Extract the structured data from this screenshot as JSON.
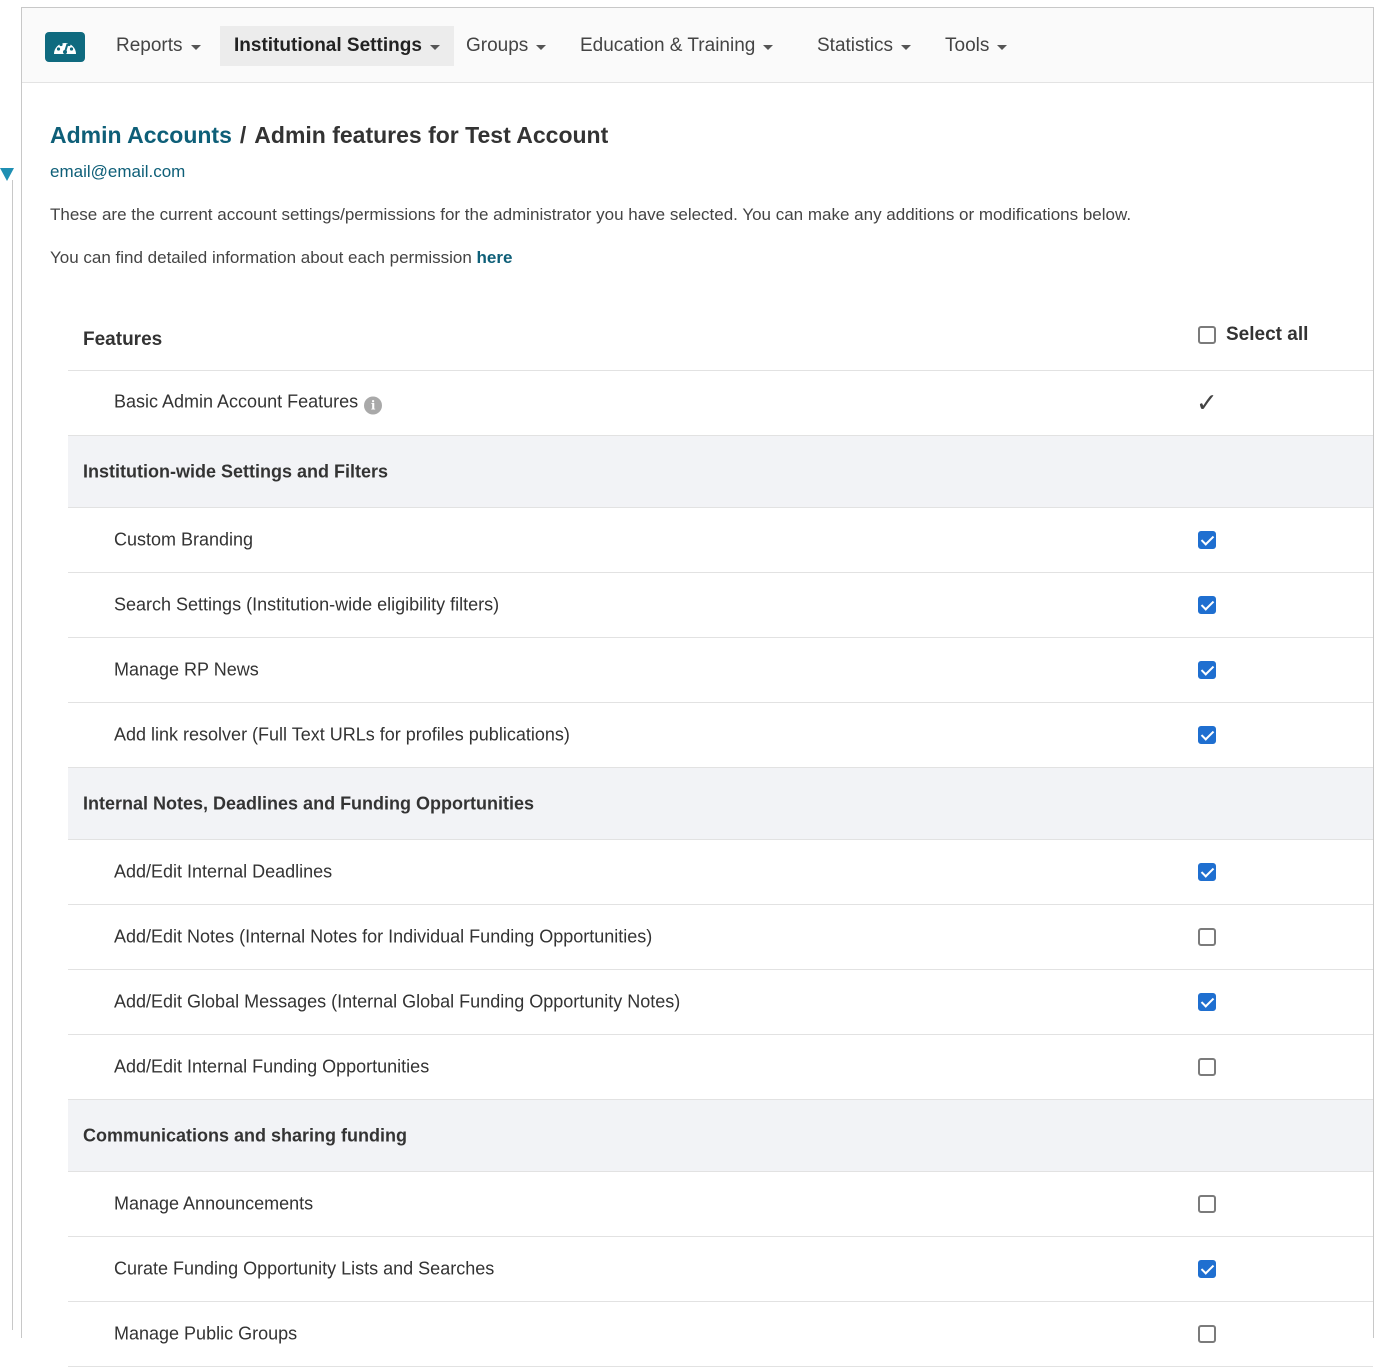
{
  "nav": {
    "logo_icon": "dashboard-gauge-icon",
    "items": [
      {
        "label": "Reports",
        "active": false
      },
      {
        "label": "Institutional Settings",
        "active": true
      },
      {
        "label": "Groups",
        "active": false
      },
      {
        "label": "Education & Training",
        "active": false
      },
      {
        "label": "Statistics",
        "active": false
      },
      {
        "label": "Tools",
        "active": false
      }
    ]
  },
  "breadcrumb": {
    "link": "Admin Accounts",
    "separator": "/",
    "current": "Admin features for Test Account"
  },
  "email": "email@email.com",
  "intro": "These are the current account settings/permissions for the administrator you have selected. You can make any additions or modifications below.",
  "info": {
    "text": "You can find detailed information about each permission ",
    "link": "here"
  },
  "table": {
    "header": "Features",
    "select_all_label": "Select all",
    "select_all_checked": false,
    "basic": {
      "label": "Basic Admin Account Features",
      "info_icon": "i",
      "mark": "✓"
    },
    "groups": [
      {
        "title": "Institution-wide Settings and Filters",
        "items": [
          {
            "label": "Custom Branding",
            "checked": true
          },
          {
            "label": "Search Settings (Institution-wide eligibility filters)",
            "checked": true
          },
          {
            "label": "Manage RP News",
            "checked": true
          },
          {
            "label": "Add link resolver (Full Text URLs for profiles publications)",
            "checked": true
          }
        ]
      },
      {
        "title": "Internal Notes, Deadlines and Funding Opportunities",
        "items": [
          {
            "label": "Add/Edit Internal Deadlines",
            "checked": true
          },
          {
            "label": "Add/Edit Notes (Internal Notes for Individual Funding Opportunities)",
            "checked": false
          },
          {
            "label": "Add/Edit Global Messages (Internal Global Funding Opportunity Notes)",
            "checked": true
          },
          {
            "label": "Add/Edit Internal Funding Opportunities",
            "checked": false
          }
        ]
      },
      {
        "title": "Communications and sharing funding",
        "items": [
          {
            "label": "Manage Announcements",
            "checked": false
          },
          {
            "label": "Curate Funding Opportunity Lists and Searches",
            "checked": true
          },
          {
            "label": "Manage Public Groups",
            "checked": false
          }
        ]
      }
    ]
  },
  "colors": {
    "accent": "#0e5f78",
    "checkbox_on": "#1f6fd0",
    "group_bg": "#f2f3f6"
  }
}
